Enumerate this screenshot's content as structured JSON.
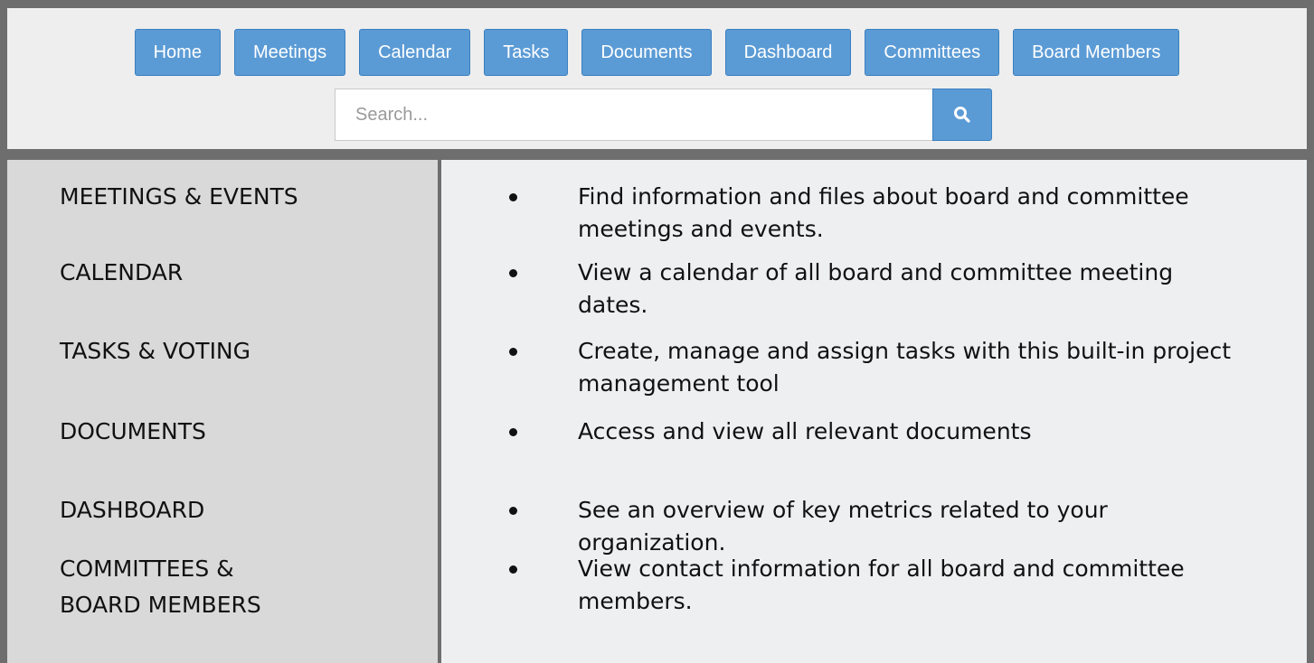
{
  "nav": {
    "items": [
      {
        "label": "Home",
        "name": "nav-home"
      },
      {
        "label": "Meetings",
        "name": "nav-meetings"
      },
      {
        "label": "Calendar",
        "name": "nav-calendar"
      },
      {
        "label": "Tasks",
        "name": "nav-tasks"
      },
      {
        "label": "Documents",
        "name": "nav-documents"
      },
      {
        "label": "Dashboard",
        "name": "nav-dashboard"
      },
      {
        "label": "Committees",
        "name": "nav-committees"
      },
      {
        "label": "Board Members",
        "name": "nav-board-members"
      }
    ]
  },
  "search": {
    "placeholder": "Search...",
    "icon": "search-icon"
  },
  "features": [
    {
      "label": "MEETINGS & EVENTS",
      "label2": "",
      "desc": "Find information and files about board and committee meetings and events."
    },
    {
      "label": "CALENDAR",
      "label2": "",
      "desc": "View a calendar of all board and committee meeting dates."
    },
    {
      "label": "TASKS & VOTING",
      "label2": "",
      "desc": "Create, manage and assign tasks with this built-in project management tool"
    },
    {
      "label": "DOCUMENTS",
      "label2": "",
      "desc": "Access and view all relevant documents"
    },
    {
      "label": "DASHBOARD",
      "label2": "",
      "desc": "See an overview of key metrics related to your organization."
    },
    {
      "label": "COMMITTEES &",
      "label2": "BOARD MEMBERS",
      "desc": "View contact information for all board and committee members."
    }
  ],
  "colors": {
    "accent": "#5b9bd5",
    "frame": "#6e6e6e",
    "left_panel": "#d9d9d9",
    "right_panel": "#eeeff1"
  }
}
